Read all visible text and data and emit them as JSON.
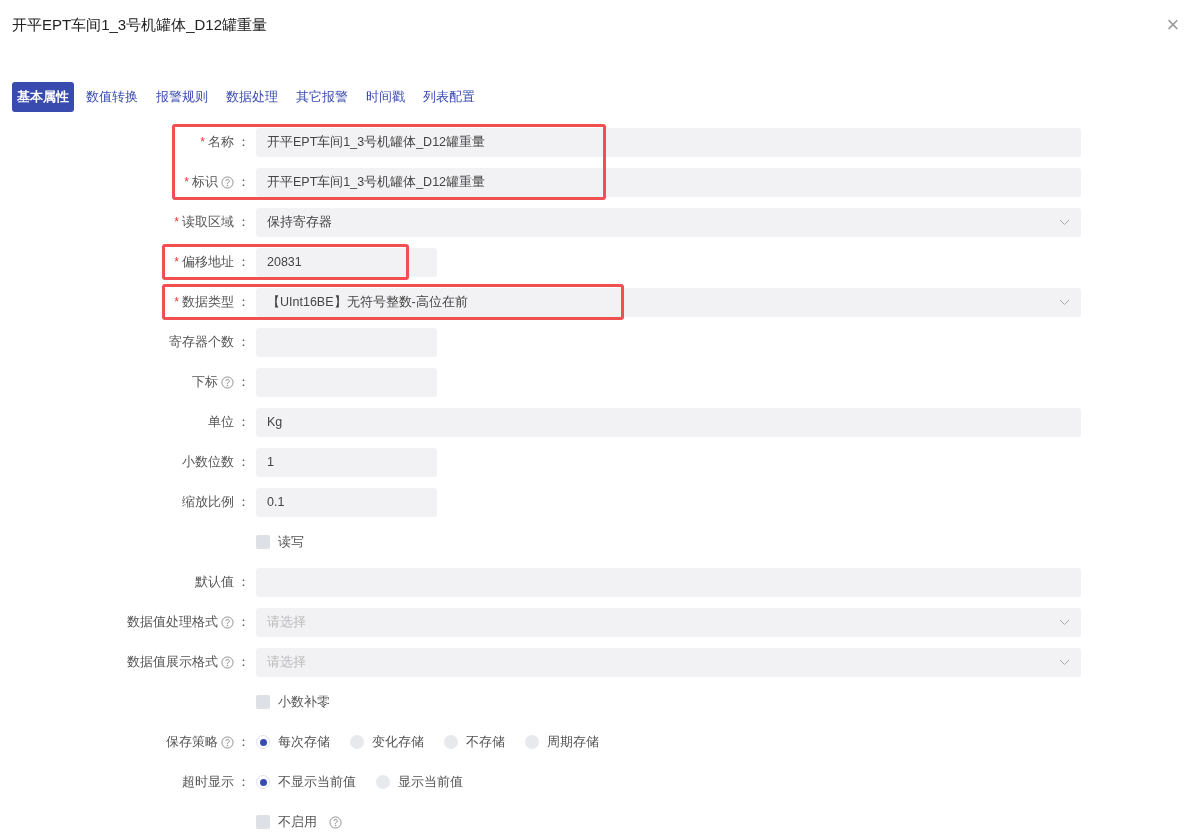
{
  "dialog": {
    "title": "开平EPT车间1_3号机罐体_D12罐重量",
    "close_label": "×"
  },
  "required_mark": "*",
  "label_suffix": "：",
  "tabs": [
    {
      "label": "基本属性",
      "selected": true
    },
    {
      "label": "数值转换",
      "selected": false
    },
    {
      "label": "报警规则",
      "selected": false
    },
    {
      "label": "数据处理",
      "selected": false
    },
    {
      "label": "其它报警",
      "selected": false
    },
    {
      "label": "时间戳",
      "selected": false
    },
    {
      "label": "列表配置",
      "selected": false
    }
  ],
  "fields": [
    {
      "kind": "text",
      "label": "名称",
      "required": true,
      "help": false,
      "wide": true,
      "value": "开平EPT车间1_3号机罐体_D12罐重量",
      "highlighted": true,
      "highlight_continues": true
    },
    {
      "kind": "text",
      "label": "标识",
      "required": true,
      "help": true,
      "wide": true,
      "value": "开平EPT车间1_3号机罐体_D12罐重量",
      "highlighted": true
    },
    {
      "kind": "select",
      "label": "读取区域",
      "required": true,
      "help": false,
      "value": "保持寄存器"
    },
    {
      "kind": "text",
      "label": "偏移地址",
      "required": true,
      "help": false,
      "wide": false,
      "value": "20831",
      "highlighted": true
    },
    {
      "kind": "select",
      "label": "数据类型",
      "required": true,
      "help": false,
      "value": "【UInt16BE】无符号整数-高位在前",
      "highlighted": true
    },
    {
      "kind": "text",
      "label": "寄存器个数",
      "required": false,
      "help": false,
      "wide": false
    },
    {
      "kind": "text",
      "label": "下标",
      "required": false,
      "help": true,
      "wide": false
    },
    {
      "kind": "text",
      "label": "单位",
      "required": false,
      "help": false,
      "wide": true,
      "value": "Kg"
    },
    {
      "kind": "text",
      "label": "小数位数",
      "required": false,
      "help": false,
      "wide": false,
      "value": "1"
    },
    {
      "kind": "text",
      "label": "缩放比例",
      "required": false,
      "help": false,
      "wide": false,
      "value": "0.1"
    },
    {
      "kind": "checkbox",
      "label": "读写",
      "checked": false,
      "help": false
    },
    {
      "kind": "text",
      "label": "默认值",
      "required": false,
      "help": false,
      "wide": true
    },
    {
      "kind": "select",
      "label": "数据值处理格式",
      "required": false,
      "help": true,
      "placeholder": "请选择"
    },
    {
      "kind": "select",
      "label": "数据值展示格式",
      "required": false,
      "help": true,
      "placeholder": "请选择"
    },
    {
      "kind": "checkbox",
      "label": "小数补零",
      "checked": false,
      "help": false
    },
    {
      "kind": "radio",
      "label": "保存策略",
      "required": false,
      "help": true,
      "options": [
        {
          "label": "每次存储",
          "selected": true
        },
        {
          "label": "变化存储",
          "selected": false
        },
        {
          "label": "不存储",
          "selected": false
        },
        {
          "label": "周期存储",
          "selected": false
        }
      ]
    },
    {
      "kind": "radio",
      "label": "超时显示",
      "required": false,
      "help": false,
      "options": [
        {
          "label": "不显示当前值",
          "selected": true
        },
        {
          "label": "显示当前值",
          "selected": false
        }
      ]
    },
    {
      "kind": "checkbox",
      "label": "不启用",
      "checked": false,
      "help": true
    }
  ]
}
